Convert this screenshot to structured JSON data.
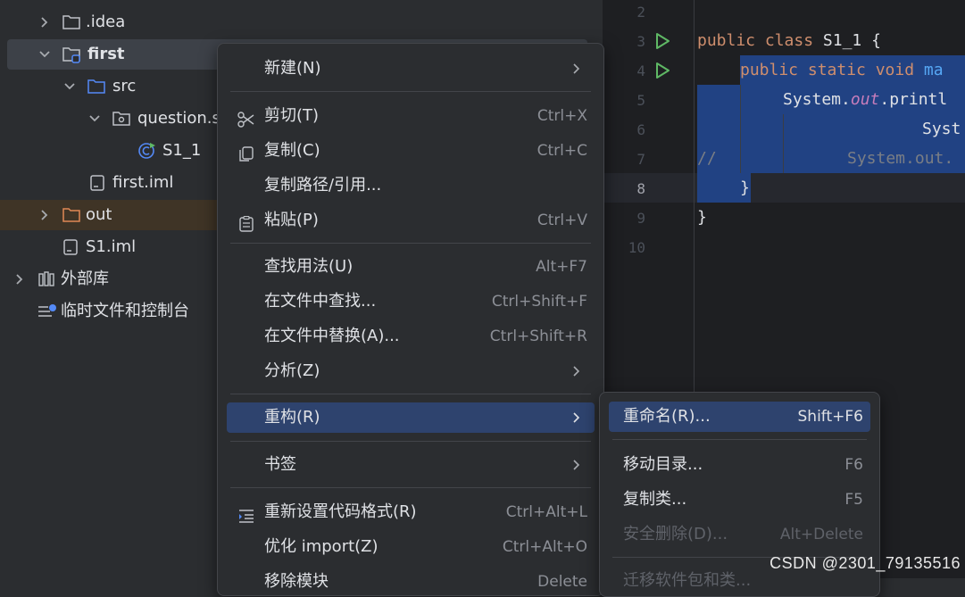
{
  "project_tree": {
    "items": [
      {
        "label": ".idea"
      },
      {
        "label": "first"
      },
      {
        "label": "src"
      },
      {
        "label": "question.s"
      },
      {
        "label": "S1_1"
      },
      {
        "label": "first.iml"
      },
      {
        "label": "out"
      },
      {
        "label": "S1.iml"
      },
      {
        "label": "外部库"
      },
      {
        "label": "临时文件和控制台"
      }
    ]
  },
  "editor": {
    "line_numbers": [
      "2",
      "3",
      "4",
      "5",
      "6",
      "7",
      "8",
      "9",
      "10"
    ],
    "code": {
      "l3_kw": "public class ",
      "l3_name": "S1_1 {",
      "l4_kw": "public static void ",
      "l4_name": "ma",
      "l5_a": "System.",
      "l5_b": "out",
      "l5_c": ".printl",
      "l6": "Syst",
      "l7_comment": "//",
      "l7_text": "System.out.",
      "l8": "}",
      "l9": "}"
    }
  },
  "context_menu": {
    "items": [
      {
        "label": "新建(N)"
      },
      {
        "label": "剪切(T)",
        "shortcut": "Ctrl+X"
      },
      {
        "label": "复制(C)",
        "shortcut": "Ctrl+C"
      },
      {
        "label": "复制路径/引用..."
      },
      {
        "label": "粘贴(P)",
        "shortcut": "Ctrl+V"
      },
      {
        "label": "查找用法(U)",
        "shortcut": "Alt+F7"
      },
      {
        "label": "在文件中查找...",
        "shortcut": "Ctrl+Shift+F"
      },
      {
        "label": "在文件中替换(A)...",
        "shortcut": "Ctrl+Shift+R"
      },
      {
        "label": "分析(Z)"
      },
      {
        "label": "重构(R)"
      },
      {
        "label": "书签"
      },
      {
        "label": "重新设置代码格式(R)",
        "shortcut": "Ctrl+Alt+L"
      },
      {
        "label": "优化 import(Z)",
        "shortcut": "Ctrl+Alt+O"
      },
      {
        "label": "移除模块",
        "shortcut": "Delete"
      }
    ]
  },
  "refactor_submenu": {
    "items": [
      {
        "label": "重命名(R)...",
        "shortcut": "Shift+F6"
      },
      {
        "label": "移动目录...",
        "shortcut": "F6"
      },
      {
        "label": "复制类...",
        "shortcut": "F5"
      },
      {
        "label": "安全删除(D)...",
        "shortcut": "Alt+Delete"
      },
      {
        "label": "迁移软件包和类..."
      }
    ]
  },
  "watermark": "CSDN @2301_79135516",
  "colors": {
    "selection": "#214283",
    "active_menu": "#2e436e",
    "keyword": "#cf8e6d",
    "function": "#56a8f5",
    "run": "#5fb865"
  }
}
